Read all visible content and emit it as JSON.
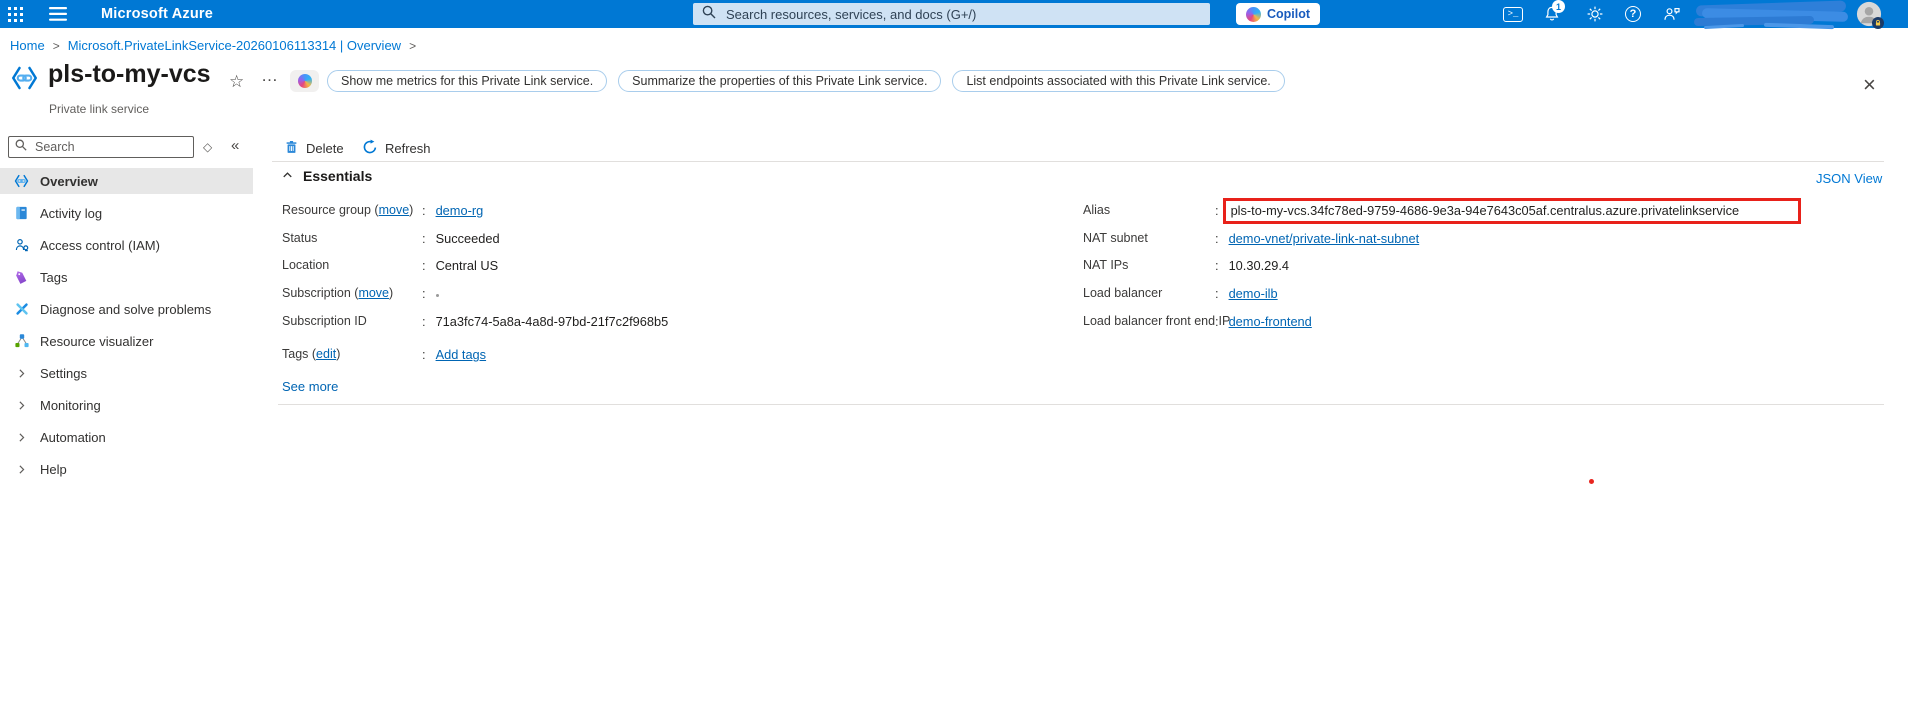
{
  "topbar": {
    "brand": "Microsoft Azure",
    "search_placeholder": "Search resources, services, and docs (G+/)",
    "copilot_label": "Copilot",
    "notification_count": "1"
  },
  "breadcrumb": {
    "home": "Home",
    "current": "Microsoft.PrivateLinkService-20260106113314 | Overview",
    "separator": ">"
  },
  "header": {
    "title": "pls-to-my-vcs",
    "subtitle": "Private link service",
    "suggestions": [
      "Show me metrics for this Private Link service.",
      "Summarize the properties of this Private Link service.",
      "List endpoints associated with this Private Link service."
    ]
  },
  "icons": {
    "star": "☆",
    "more": "…",
    "close": "×",
    "collapse": "«",
    "pin": "◇",
    "shell": ">_",
    "help": "?"
  },
  "sidebar": {
    "search_placeholder": "Search",
    "items": [
      {
        "label": "Overview",
        "selected": true
      },
      {
        "label": "Activity log"
      },
      {
        "label": "Access control (IAM)"
      },
      {
        "label": "Tags"
      },
      {
        "label": "Diagnose and solve problems"
      },
      {
        "label": "Resource visualizer"
      },
      {
        "label": "Settings"
      },
      {
        "label": "Monitoring"
      },
      {
        "label": "Automation"
      },
      {
        "label": "Help"
      }
    ]
  },
  "commandbar": {
    "delete_label": "Delete",
    "refresh_label": "Refresh"
  },
  "essentials": {
    "title": "Essentials",
    "json_view_label": "JSON View",
    "colon": ":",
    "see_more_label": "See more",
    "left": [
      {
        "label_pre": "Resource group (",
        "label_link": "move",
        "label_post": ")",
        "value": "demo-rg"
      },
      {
        "label": "Status",
        "value": "Succeeded"
      },
      {
        "label": "Location",
        "value": "Central US"
      },
      {
        "label_pre": "Subscription (",
        "label_link": "move",
        "label_post": ")",
        "value": ""
      },
      {
        "label": "Subscription ID",
        "value": "71a3fc74-5a8a-4a8d-97bd-21f7c2f968b5"
      },
      {
        "label_pre": "Tags (",
        "label_link": "edit",
        "label_post": ")",
        "value": "Add tags"
      }
    ],
    "right": [
      {
        "label": "Alias",
        "value": "pls-to-my-vcs.34fc78ed-9759-4686-9e3a-94e7643c05af.centralus.azure.privatelinkservice",
        "highlighted": true
      },
      {
        "label": "NAT subnet",
        "value": "demo-vnet/private-link-nat-subnet"
      },
      {
        "label": "NAT IPs",
        "value": "10.30.29.4"
      },
      {
        "label": "Load balancer",
        "value": "demo-ilb"
      },
      {
        "label": "Load balancer front end IP",
        "value": "demo-frontend"
      }
    ]
  },
  "colors": {
    "topbar_bg": "#0078d4",
    "breadcrumb_link": "#0078d4",
    "essentials_link": "#0065b3",
    "highlight_border": "#e8211a",
    "copilot_text": "#185abd",
    "selected_nav_bg": "#e7e7e7"
  }
}
